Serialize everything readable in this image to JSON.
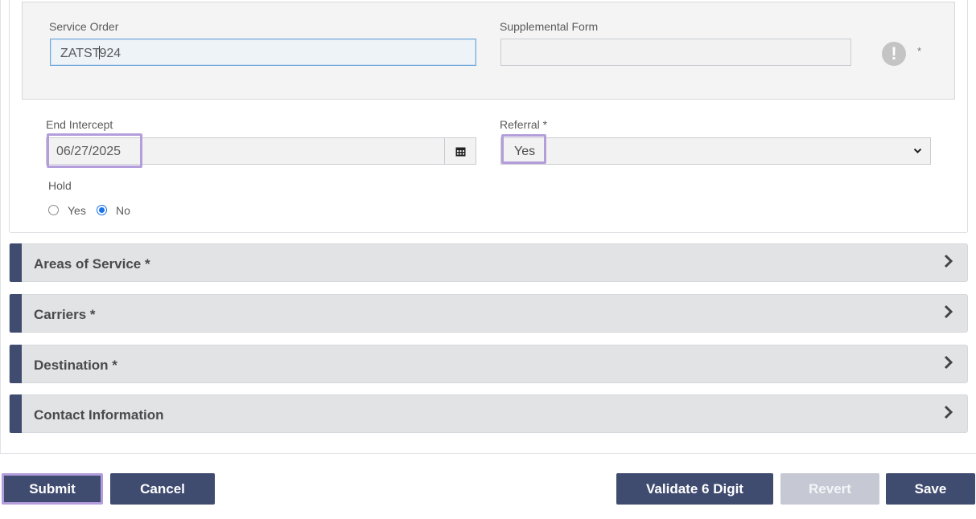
{
  "service_order": {
    "label": "Service Order",
    "value_before_caret": "ZATST",
    "value_after_caret": "924"
  },
  "supplemental_form": {
    "label": "Supplemental Form",
    "value": "",
    "required_marker": "*",
    "icon": "exclamation-icon"
  },
  "end_intercept": {
    "label": "End Intercept",
    "value": "06/27/2025",
    "icon": "calendar-icon"
  },
  "referral": {
    "label": "Referral *",
    "value": "Yes"
  },
  "hold": {
    "label": "Hold",
    "options": [
      {
        "label": "Yes",
        "checked": false
      },
      {
        "label": "No",
        "checked": true
      }
    ]
  },
  "sections": [
    {
      "title": "Areas of Service *"
    },
    {
      "title": "Carriers *"
    },
    {
      "title": "Destination *"
    },
    {
      "title": "Contact Information"
    }
  ],
  "buttons": {
    "submit": "Submit",
    "cancel": "Cancel",
    "validate": "Validate 6 Digit",
    "revert": "Revert",
    "save": "Save"
  },
  "colors": {
    "accent": "#404b70",
    "highlight": "#b39ddb",
    "focus": "#6fa8dc",
    "radio": "#1a73e8"
  }
}
